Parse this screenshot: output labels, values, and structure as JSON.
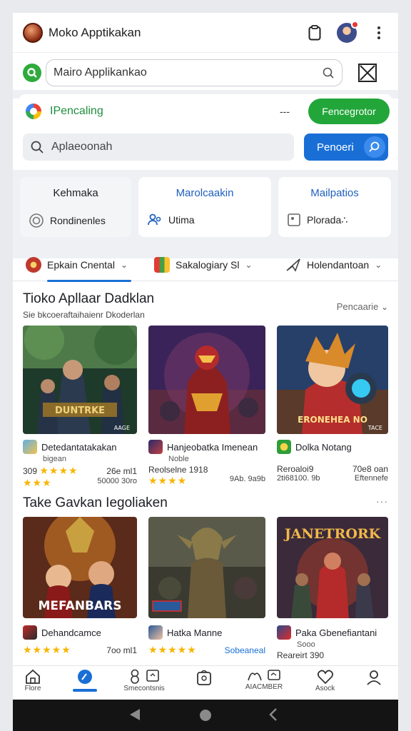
{
  "header": {
    "title": "Moko Apptikakan",
    "notif_count": ""
  },
  "search": {
    "value": "Mairo Applikankao"
  },
  "promo": {
    "label": "IPencaling",
    "dash": "---",
    "green_button": "Fencegrotor",
    "inner_placeholder": "Aplaeoonah",
    "blue_button": "Penoeri"
  },
  "tiles": [
    {
      "title": "Kehmaka",
      "sub": "Rondinenles"
    },
    {
      "title": "Marolcaakin",
      "sub": "Utima"
    },
    {
      "title": "Mailpatios",
      "sub": "Plorada∴"
    }
  ],
  "filters": [
    {
      "label": "Epkain Cnental"
    },
    {
      "label": "Sakalogiary Sl"
    },
    {
      "label": "Holendantoan"
    }
  ],
  "section1": {
    "title": "Tioko Apllaar Dadklan",
    "subtitle": "Sie bkcoeraftaihaienr Dkoderlan",
    "link": "Pencaarie",
    "cards": [
      {
        "name": "Detedantatakakan",
        "dev": "bigean",
        "rating": "309",
        "downloads": "26e ml1",
        "extra_left": "",
        "extra_right": "50000 30ro",
        "badge": "AAGE",
        "art": "DUNTRKE"
      },
      {
        "name": "Hanjeobatka Imenean",
        "dev": "Noble",
        "rating": "",
        "downloads": "",
        "extra_left": "Reolselne 1918",
        "extra_right": "9Ab. 9a9b",
        "badge": "",
        "art": ""
      },
      {
        "name": "Dolka Notang",
        "dev": "",
        "rating": "",
        "downloads": "70e8 oan",
        "extra_left": "Reroaloi9",
        "extra_right": "Eftennefe",
        "extra_left2": "2ti68100. 9b",
        "badge": "TACE",
        "art": "ERONEHEA NO"
      }
    ]
  },
  "section2": {
    "title": "Take Gavkan Iegoliaken",
    "more": "···",
    "cards": [
      {
        "name": "Dehandcamce",
        "dev": "",
        "downloads": "7oo ml1",
        "art": "MEFANBARS"
      },
      {
        "name": "Hatka Manne",
        "dev": "",
        "downloads": "Sobeaneal",
        "art": ""
      },
      {
        "name": "Paka Gbenefiantani",
        "dev": "Sooo",
        "downloads": "Reareirt 390",
        "art": "JANETRORK"
      }
    ]
  },
  "bottom_nav": [
    {
      "label": "Flore"
    },
    {
      "label": ""
    },
    {
      "label": "Smecontsnis"
    },
    {
      "label": ""
    },
    {
      "label": "AIACMBER"
    },
    {
      "label": "Asock"
    },
    {
      "label": ""
    }
  ],
  "colors": {
    "accent_blue": "#1a6fd6",
    "accent_green": "#22a63a",
    "star": "#f7b500"
  }
}
